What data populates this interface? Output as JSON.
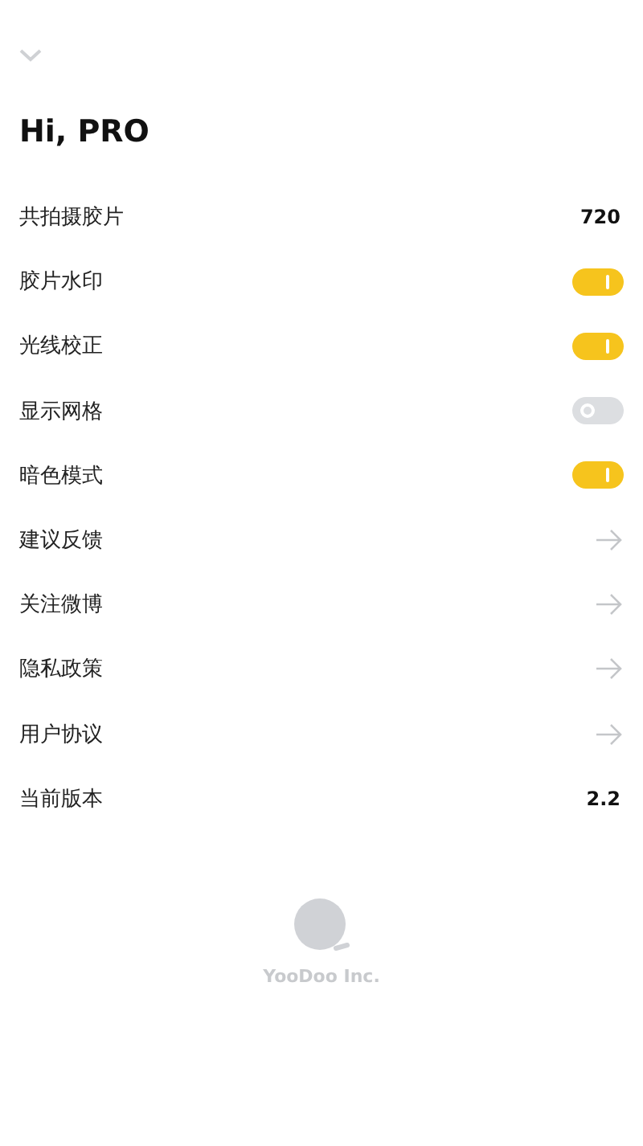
{
  "title": "Hi, PRO",
  "rows": [
    {
      "kind": "value",
      "label": "共拍摄胶片",
      "value": "720"
    },
    {
      "kind": "toggle",
      "label": "胶片水印",
      "on": true
    },
    {
      "kind": "toggle",
      "label": "光线校正",
      "on": true
    },
    {
      "kind": "toggle",
      "label": "显示网格",
      "on": false
    },
    {
      "kind": "toggle",
      "label": "暗色模式",
      "on": true
    },
    {
      "kind": "link",
      "label": "建议反馈"
    },
    {
      "kind": "link",
      "label": "关注微博"
    },
    {
      "kind": "link",
      "label": "隐私政策"
    },
    {
      "kind": "link",
      "label": "用户协议"
    },
    {
      "kind": "value",
      "label": "当前版本",
      "value": "2.2"
    }
  ],
  "footer": {
    "company": "YooDoo Inc."
  }
}
